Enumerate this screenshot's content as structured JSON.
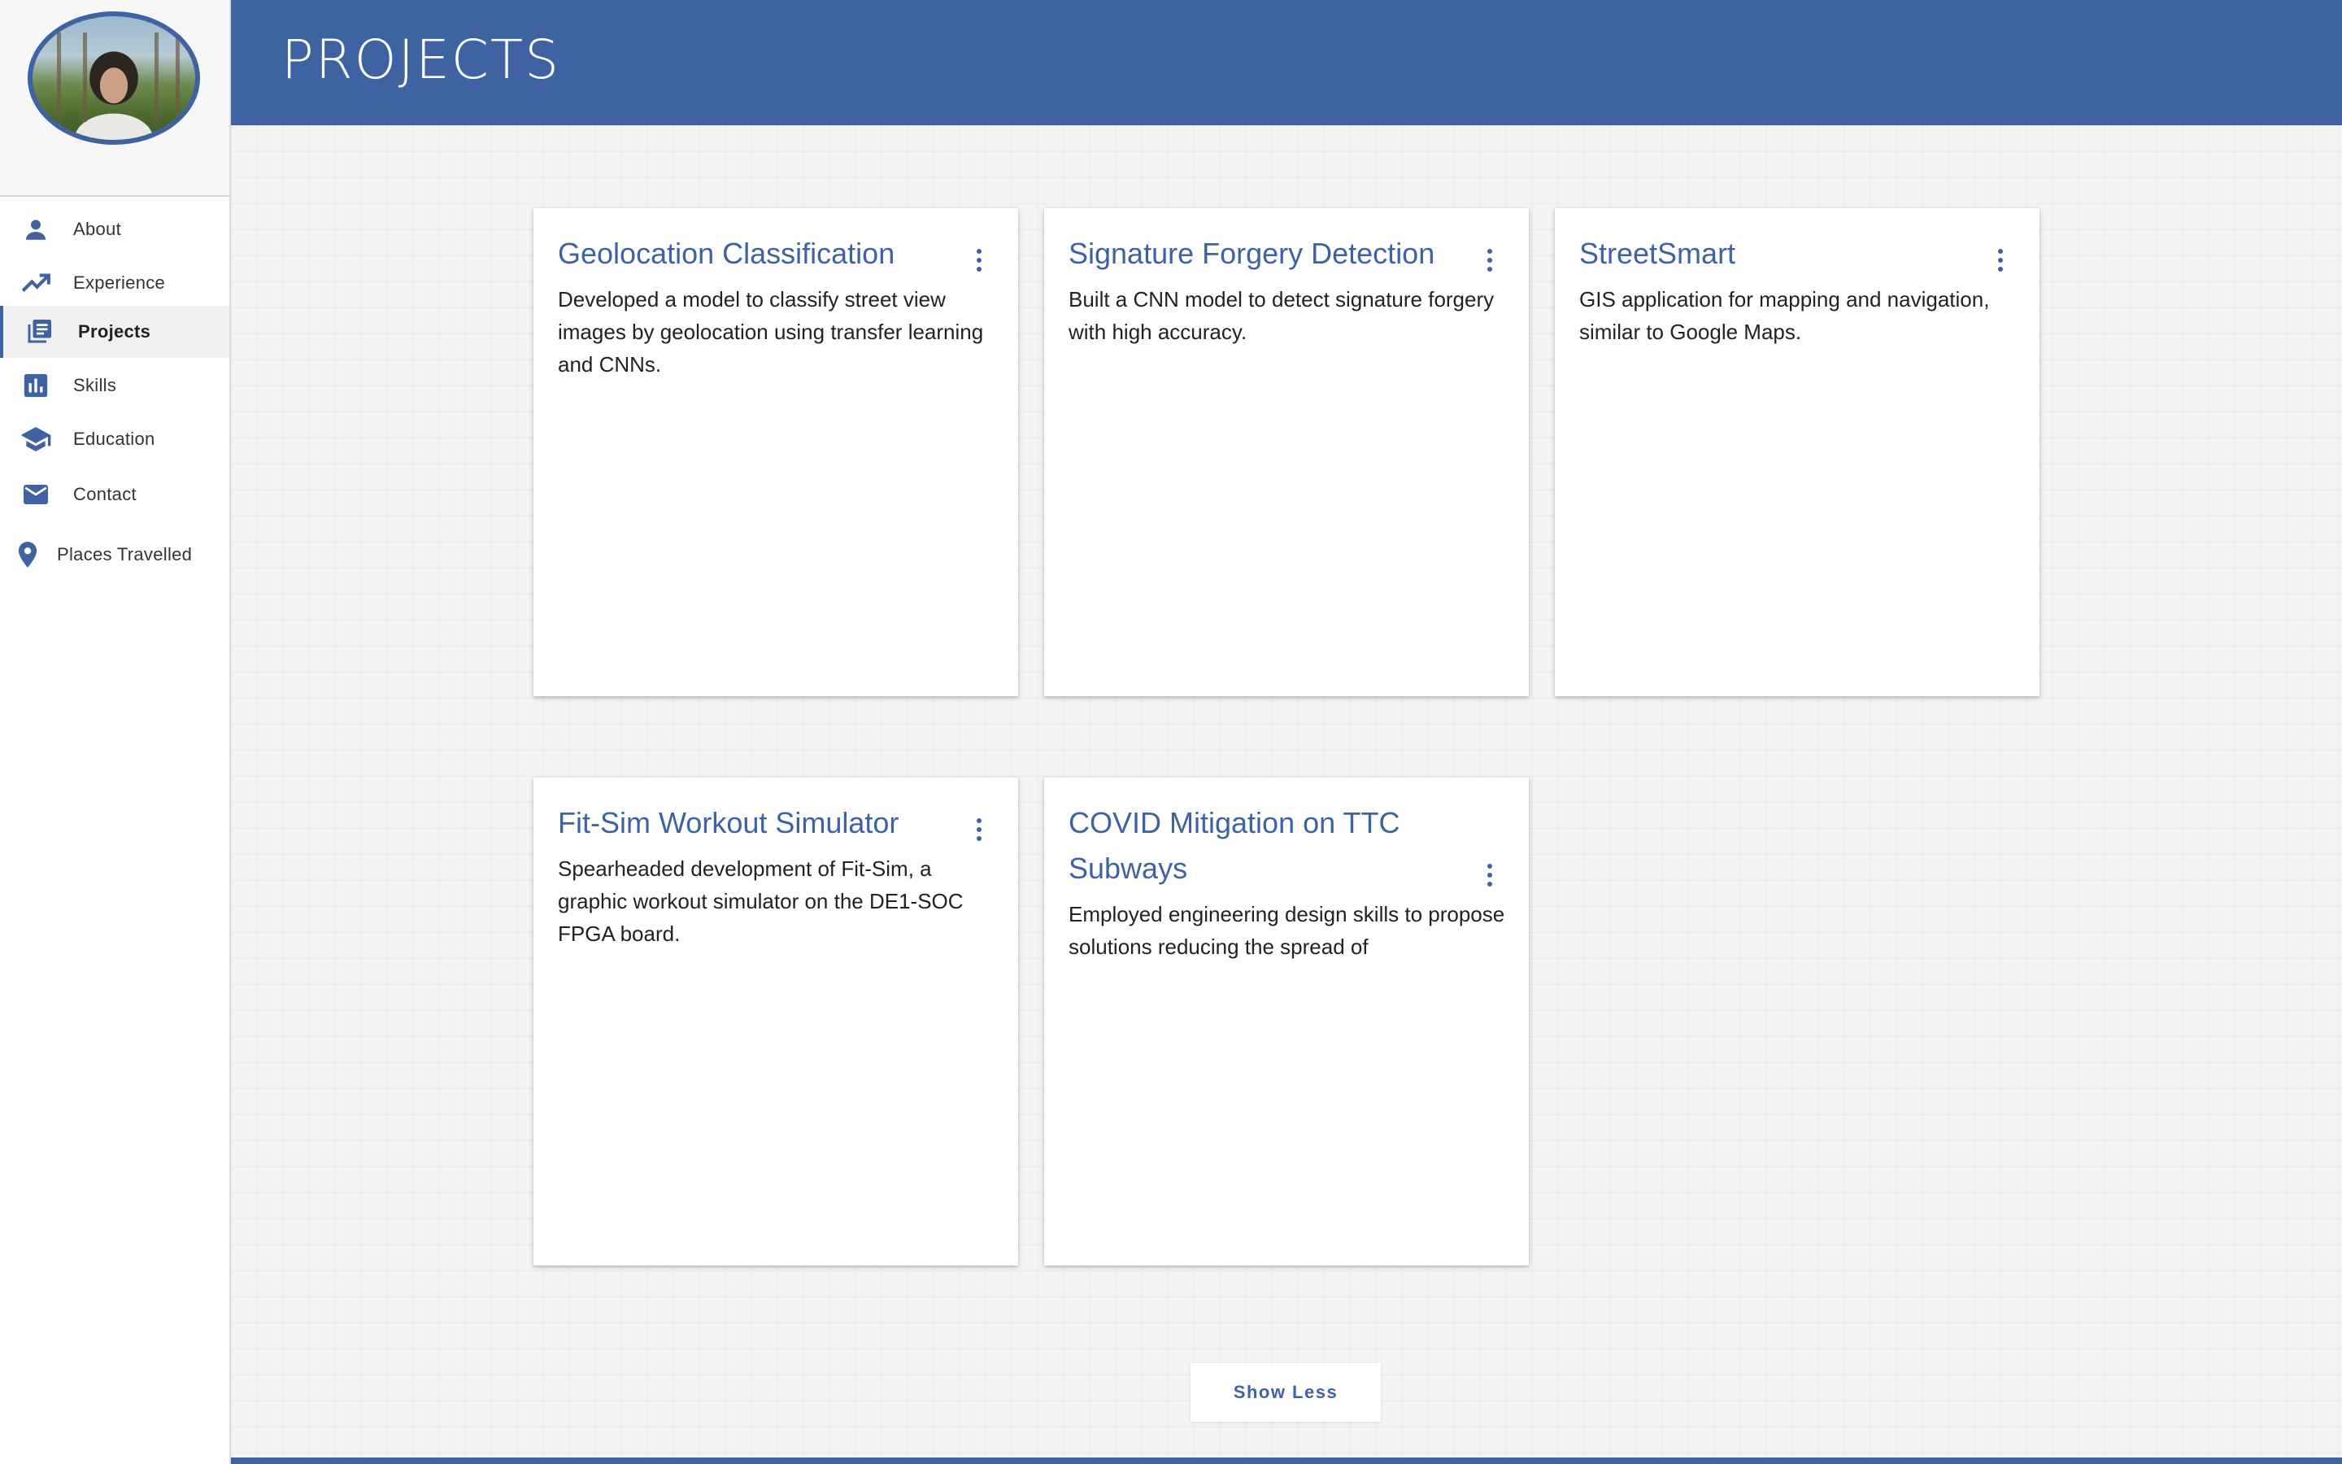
{
  "header": {
    "title": "PROJECTS"
  },
  "sidebar": {
    "items": [
      {
        "label": "About",
        "icon": "person-icon"
      },
      {
        "label": "Experience",
        "icon": "trending-up-icon"
      },
      {
        "label": "Projects",
        "icon": "library-books-icon",
        "active": true
      },
      {
        "label": "Skills",
        "icon": "bar-chart-icon"
      },
      {
        "label": "Education",
        "icon": "graduation-cap-icon"
      },
      {
        "label": "Contact",
        "icon": "mail-icon"
      },
      {
        "label": "Places Travelled",
        "icon": "location-pin-icon"
      }
    ]
  },
  "projects": [
    {
      "title": "Geolocation Classification",
      "description": "Developed a model to classify street view images by geolocation using transfer learning and CNNs."
    },
    {
      "title": "Signature Forgery Detection",
      "description": "Built a CNN model to detect signature forgery with high accuracy."
    },
    {
      "title": "StreetSmart",
      "description": "GIS application for mapping and navigation, similar to Google Maps."
    },
    {
      "title": "Fit-Sim Workout Simulator",
      "description": "Spearheaded development of Fit-Sim, a graphic workout simulator on the DE1-SOC FPGA board."
    },
    {
      "title": "COVID Mitigation on TTC Subways",
      "description": "Employed engineering design skills to propose solutions reducing the spread of"
    }
  ],
  "actions": {
    "show_less_label": "Show Less"
  },
  "colors": {
    "accent": "#3f62a3",
    "background": "#f4f4f4",
    "card": "#ffffff"
  }
}
